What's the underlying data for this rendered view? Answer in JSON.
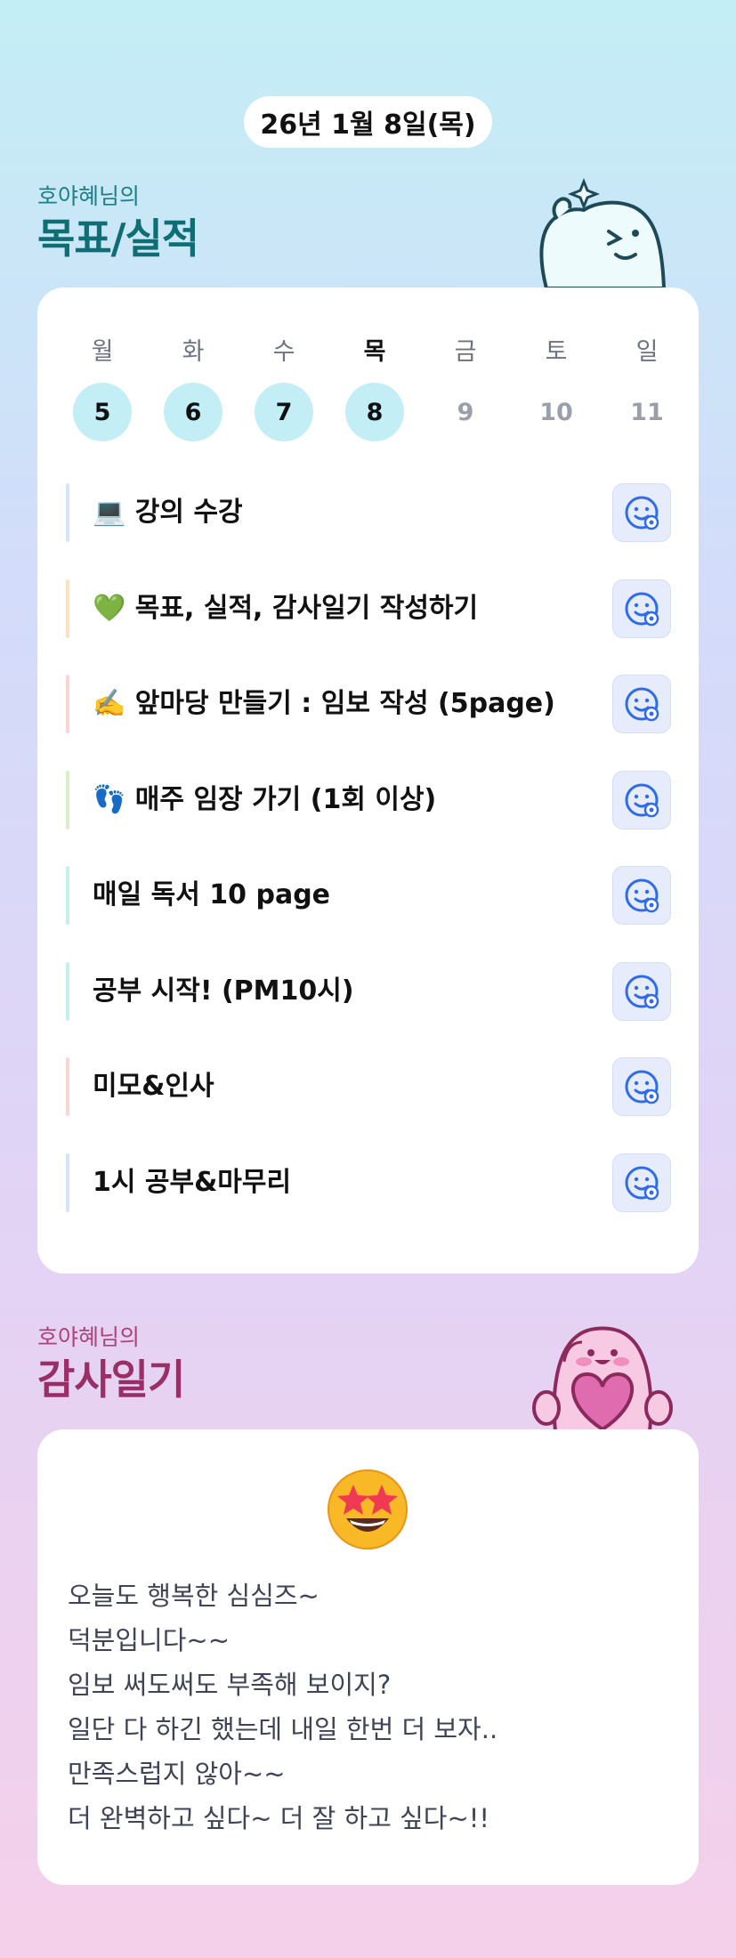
{
  "date": "26년 1월 8일(목)",
  "goals": {
    "owner_label": "호야혜님의",
    "title": "목표/실적",
    "week_days": [
      "월",
      "화",
      "수",
      "목",
      "금",
      "토",
      "일"
    ],
    "week_dates": [
      "5",
      "6",
      "7",
      "8",
      "9",
      "10",
      "11"
    ],
    "today_index": 3,
    "tasks": [
      {
        "label": "💻 강의 수강",
        "bar_color": "#d9e3f7"
      },
      {
        "label": "💚 목표, 실적, 감사일기 작성하기",
        "bar_color": "#fbe3c2"
      },
      {
        "label": "✍️ 앞마당 만들기 : 임보 작성 (5page)",
        "bar_color": "#fbd5d2"
      },
      {
        "label": "👣 매주 임장 가기 (1회 이상)",
        "bar_color": "#d7f0c8"
      },
      {
        "label": "매일 독서 10 page",
        "bar_color": "#c6efe8"
      },
      {
        "label": "공부 시작! (PM10시)",
        "bar_color": "#c6eff2"
      },
      {
        "label": "미모&인사",
        "bar_color": "#fbd5d2"
      },
      {
        "label": "1시 공부&마무리",
        "bar_color": "#d9e3f7"
      }
    ],
    "action_icon": "smiley-add-icon"
  },
  "diary": {
    "owner_label": "호야혜님의",
    "title": "감사일기",
    "mood_icon": "star-struck-emoji-icon",
    "lines": [
      "오늘도 행복한 심심즈~",
      "덕분입니다~~",
      "임보 써도써도 부족해 보이지?",
      "일단 다 하긴 했는데 내일 한번 더 보자..",
      "만족스럽지 않아~~",
      "더 완벽하고 싶다~ 더 잘 하고 싶다~!!"
    ]
  },
  "colors": {
    "accent_teal": "#0f6d74",
    "accent_pink": "#9a2f68",
    "done_circle": "#c3eef5",
    "icon_blue": "#2f6bea"
  }
}
